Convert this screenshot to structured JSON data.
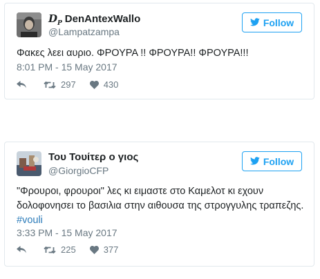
{
  "colors": {
    "accent": "#1da1f2",
    "hashtag": "#2b7bb9",
    "muted": "#697882",
    "border": "#e1e8ed"
  },
  "tweets": [
    {
      "avatar_icon": "user-photo-avatar",
      "name_logo": "D",
      "name_logo_sub": "P",
      "name": "DenAntexWallo",
      "handle": "@Lampatzampa",
      "follow_label": "Follow",
      "text": "Φακες λεει αυριο. ΦΡΟΥΡΑ !! ΦΡΟΥΡΑ!! ΦΡΟΥΡΑ!!!",
      "timestamp": "8:01 PM - 15 May 2017",
      "retweets": "297",
      "likes": "430"
    },
    {
      "avatar_icon": "user-photo-avatar",
      "name": "Του Τουίτερ ο γιος",
      "handle": "@GiorgioCFP",
      "follow_label": "Follow",
      "text": "\"Φρουροι, φρουροι\" λες κι ειμαστε στο Καμελοτ κι εχουν δολοφονησει το βασιλια στην αιθουσα της στρογγυλης τραπεζης.",
      "hashtag": "#vouli",
      "timestamp": "3:33 PM - 15 May 2017",
      "retweets": "225",
      "likes": "377"
    }
  ]
}
